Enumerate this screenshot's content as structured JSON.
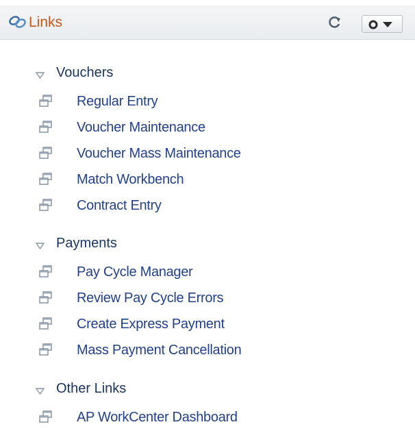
{
  "header": {
    "title": "Links",
    "title_color": "#c4561a"
  },
  "groups": [
    {
      "label": "Vouchers",
      "links": [
        "Regular Entry",
        "Voucher Maintenance",
        "Voucher Mass Maintenance",
        "Match Workbench",
        "Contract Entry"
      ]
    },
    {
      "label": "Payments",
      "links": [
        "Pay Cycle Manager",
        "Review Pay Cycle Errors",
        "Create Express Payment",
        "Mass Payment Cancellation"
      ]
    },
    {
      "label": "Other Links",
      "links": [
        "AP WorkCenter Dashboard"
      ]
    }
  ],
  "icons": {
    "header": "links-icon",
    "refresh": "refresh-icon",
    "actions": "gear-dropdown-icon",
    "group_toggle": "triangle-down-icon",
    "link": "new-window-icon"
  }
}
